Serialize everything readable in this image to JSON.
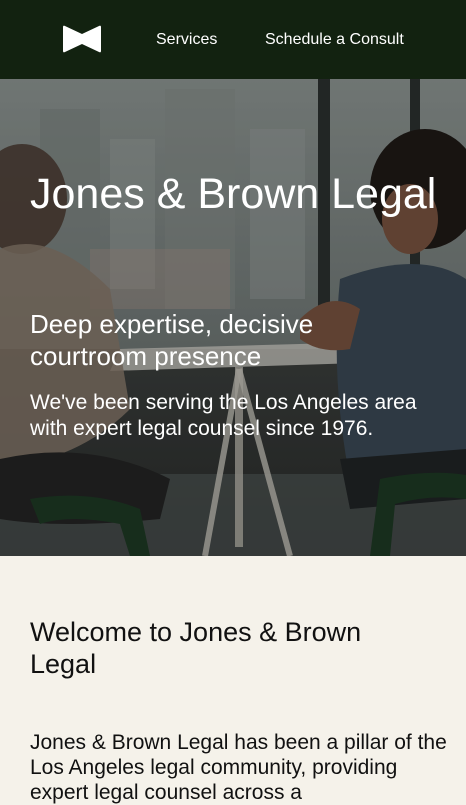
{
  "header": {
    "logo_icon": "bowtie-logo-icon",
    "nav": [
      {
        "label": "Services"
      },
      {
        "label": "Schedule a Consult"
      }
    ],
    "background_color": "#122210"
  },
  "hero": {
    "title": "Jones & Brown Legal",
    "subtitle": "Deep expertise, decisive courtroom presence",
    "text": "We've been serving the Los Angeles area with expert legal counsel since 1976."
  },
  "welcome": {
    "heading": "Welcome to Jones & Brown Legal",
    "text": "Jones & Brown Legal has been a pillar of the Los Angeles legal community, providing expert legal counsel across a"
  },
  "colors": {
    "header_bg": "#122210",
    "page_bg": "#f5f2ea",
    "hero_text": "#ffffff"
  }
}
